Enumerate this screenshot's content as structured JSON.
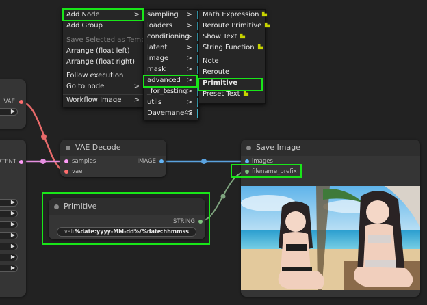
{
  "canvas_menu": {
    "items": [
      {
        "label": "Add Node",
        "submenu": true
      },
      {
        "label": "Add Group",
        "submenu": false
      },
      {
        "label": "Save Selected as Template",
        "submenu": false,
        "disabled": true
      },
      {
        "label": "Arrange (float left)",
        "submenu": false
      },
      {
        "label": "Arrange (float right)",
        "submenu": false
      },
      {
        "label": "Follow execution",
        "submenu": false
      },
      {
        "label": "Go to node",
        "submenu": true
      },
      {
        "label": "Workflow Image",
        "submenu": true
      }
    ]
  },
  "category_menu": {
    "items": [
      "sampling",
      "loaders",
      "conditioning",
      "latent",
      "image",
      "mask",
      "advanced",
      "_for_testing",
      "utils",
      "Davemane42"
    ],
    "selected": "advanced"
  },
  "advanced_menu": {
    "items": [
      {
        "label": "Math Expression",
        "badge": true
      },
      {
        "label": "Reroute Primitive",
        "badge": true
      },
      {
        "label": "Show Text",
        "badge": true
      },
      {
        "label": "String Function",
        "badge": true
      },
      {
        "label": "Note",
        "badge": false
      },
      {
        "label": "Reroute",
        "badge": false
      },
      {
        "label": "Primitive",
        "badge": false
      },
      {
        "label": "Preset Text",
        "badge": true
      }
    ],
    "selected": "Primitive"
  },
  "nodes": {
    "left_top": {
      "output_label": "VAE",
      "caret": "▶"
    },
    "left_mid": {
      "output_label": "LATENT",
      "caret": "▶"
    },
    "vae_decode": {
      "title": "VAE Decode",
      "inputs": [
        "samples",
        "vae"
      ],
      "output": "IMAGE"
    },
    "save_image": {
      "title": "Save Image",
      "inputs": [
        "images",
        "filename_prefix"
      ]
    },
    "primitive": {
      "title": "Primitive",
      "output": "STRING",
      "widget_label": "value",
      "widget_value": "%date:yyyy-MM-dd%/%date:hhmmss"
    }
  },
  "colors": {
    "highlight": "#19e619",
    "vae_link": "#ff6e6e",
    "latent_link": "#ff9cf9",
    "image_link": "#64b5f6",
    "string_link": "#7fbf7f",
    "menu_bar": "#3fb3c8",
    "badge": "#c8d400"
  }
}
